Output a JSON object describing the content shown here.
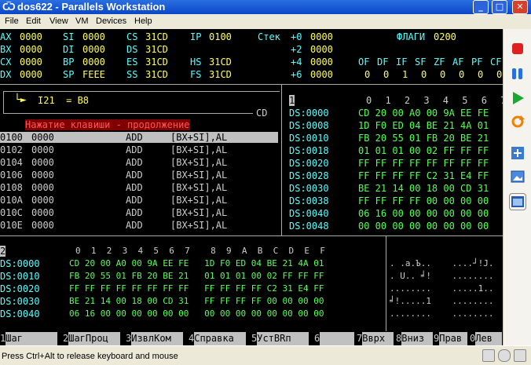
{
  "window": {
    "title": "dos622 - Parallels Workstation",
    "icon": "parallels-icon",
    "min_label": "_",
    "max_label": "□",
    "close_label": "✕"
  },
  "menu": {
    "items": [
      "File",
      "Edit",
      "View",
      "VM",
      "Devices",
      "Help"
    ]
  },
  "registers": {
    "rows": [
      [
        "AX",
        "0000",
        "SI",
        "0000",
        "CS",
        "31CD",
        "IP",
        "0100"
      ],
      [
        "BX",
        "0000",
        "DI",
        "0000",
        "DS",
        "31CD",
        "",
        ""
      ],
      [
        "CX",
        "0000",
        "BP",
        "0000",
        "ES",
        "31CD",
        "HS",
        "31CD"
      ],
      [
        "DX",
        "0000",
        "SP",
        "FEEE",
        "SS",
        "31CD",
        "FS",
        "31CD"
      ]
    ]
  },
  "stack": {
    "label": "Стек",
    "rows": [
      [
        "+0",
        "0000"
      ],
      [
        "+2",
        "0000"
      ],
      [
        "+4",
        "0000"
      ],
      [
        "+6",
        "0000"
      ]
    ]
  },
  "flags": {
    "title": "ФЛАГИ",
    "value": "0200",
    "names": [
      "OF",
      "DF",
      "IF",
      "SF",
      "ZF",
      "AF",
      "PF",
      "CF"
    ],
    "values": [
      "0",
      "0",
      "1",
      "0",
      "0",
      "0",
      "0",
      "0"
    ]
  },
  "code": {
    "interrupt": "I21  = B8",
    "byte_label": "CD",
    "message": "Нажатие клавиши - продолжение",
    "rows": [
      [
        "0100",
        "0000",
        "ADD",
        "[BX+SI],AL"
      ],
      [
        "0102",
        "0000",
        "ADD",
        "[BX+SI],AL"
      ],
      [
        "0104",
        "0000",
        "ADD",
        "[BX+SI],AL"
      ],
      [
        "0106",
        "0000",
        "ADD",
        "[BX+SI],AL"
      ],
      [
        "0108",
        "0000",
        "ADD",
        "[BX+SI],AL"
      ],
      [
        "010A",
        "0000",
        "ADD",
        "[BX+SI],AL"
      ],
      [
        "010C",
        "0000",
        "ADD",
        "[BX+SI],AL"
      ],
      [
        "010E",
        "0000",
        "ADD",
        "[BX+SI],AL"
      ]
    ]
  },
  "dump_right": {
    "panel_no": "1",
    "header": "0 1 2 3 4 5 6 7",
    "rows": [
      [
        "DS:0000",
        "CD 20 00 A0 00 9A EE FE"
      ],
      [
        "DS:0008",
        "1D F0 ED 04 BE 21 4A 01"
      ],
      [
        "DS:0010",
        "FB 20 55 01 FB 20 BE 21"
      ],
      [
        "DS:0018",
        "01 01 01 00 02 FF FF FF"
      ],
      [
        "DS:0020",
        "FF FF FF FF FF FF FF FF"
      ],
      [
        "DS:0028",
        "FF FF FF FF C2 31 E4 FF"
      ],
      [
        "DS:0030",
        "BE 21 14 00 18 00 CD 31"
      ],
      [
        "DS:0038",
        "FF FF FF FF 00 00 00 00"
      ],
      [
        "DS:0040",
        "06 16 00 00 00 00 00 00"
      ],
      [
        "DS:0048",
        "00 00 00 00 00 00 00 00"
      ]
    ]
  },
  "dump_bottom": {
    "panel_no": "2",
    "header": "0  1  2  3  4  5  6  7    8  9  A  B  C  D  E  F",
    "rows": [
      [
        "DS:0000",
        "CD 20 00 A0 00 9A EE FE   1D F0 ED 04 BE 21 4A 01",
        ". .a.Ъ..    ....┘!J."
      ],
      [
        "DS:0010",
        "FB 20 55 01 FB 20 BE 21   01 01 01 00 02 FF FF FF",
        ". U.. ╛!    ........"
      ],
      [
        "DS:0020",
        "FF FF FF FF FF FF FF FF   FF FF FF FF C2 31 E4 FF",
        "........    .....1.."
      ],
      [
        "DS:0030",
        "BE 21 14 00 18 00 CD 31   FF FF FF FF 00 00 00 00",
        "╛!.....1    ........"
      ],
      [
        "DS:0040",
        "06 16 00 00 00 00 00 00   00 00 00 00 00 00 00 00",
        "........    ........"
      ]
    ]
  },
  "fkeys": [
    [
      "1",
      "Шаг"
    ],
    [
      "2",
      "ШагПроц"
    ],
    [
      "3",
      "ИзвлКом"
    ],
    [
      "4",
      "Справка"
    ],
    [
      "5",
      "УстВRп"
    ],
    [
      "6",
      ""
    ],
    [
      "7",
      "Вврх"
    ],
    [
      "8",
      "Вниз"
    ],
    [
      "9",
      "Прав"
    ],
    [
      "0",
      "Лев"
    ]
  ],
  "sidebar": {
    "buttons": [
      "stop-icon",
      "pause-icon",
      "play-icon",
      "reset-icon",
      "fullscreen-icon",
      "screenshot-icon",
      "window-icon"
    ]
  },
  "status": {
    "message": "Press Ctrl+Alt to release keyboard and mouse"
  }
}
